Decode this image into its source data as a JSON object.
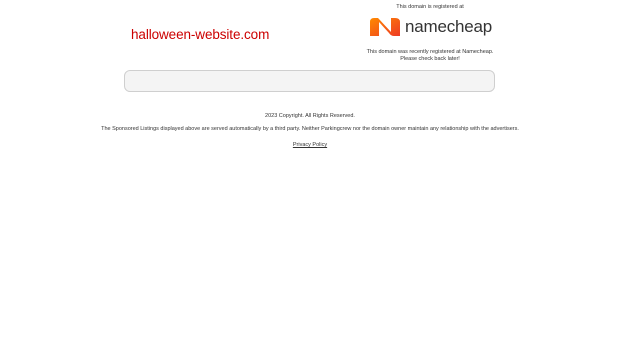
{
  "domain": {
    "name": "halloween-website.com",
    "color": "#cc0000"
  },
  "registrar": {
    "registered_at_text": "This domain is registered at",
    "logo_text": "namecheap",
    "logo_icon": "namecheap-logo-icon",
    "logo_color": "#ff5a1f",
    "recent_line1": "This domain was recently registered at Namecheap.",
    "recent_line2": "Please check back later!"
  },
  "footer": {
    "copyright": "2023 Copyright. All Rights Reserved.",
    "disclaimer": "The Sponsored Listings displayed above are served automatically by a third party. Neither Parkingcrew nor the domain owner maintain any relationship with the advertisers.",
    "privacy_link": "Privacy Policy"
  }
}
